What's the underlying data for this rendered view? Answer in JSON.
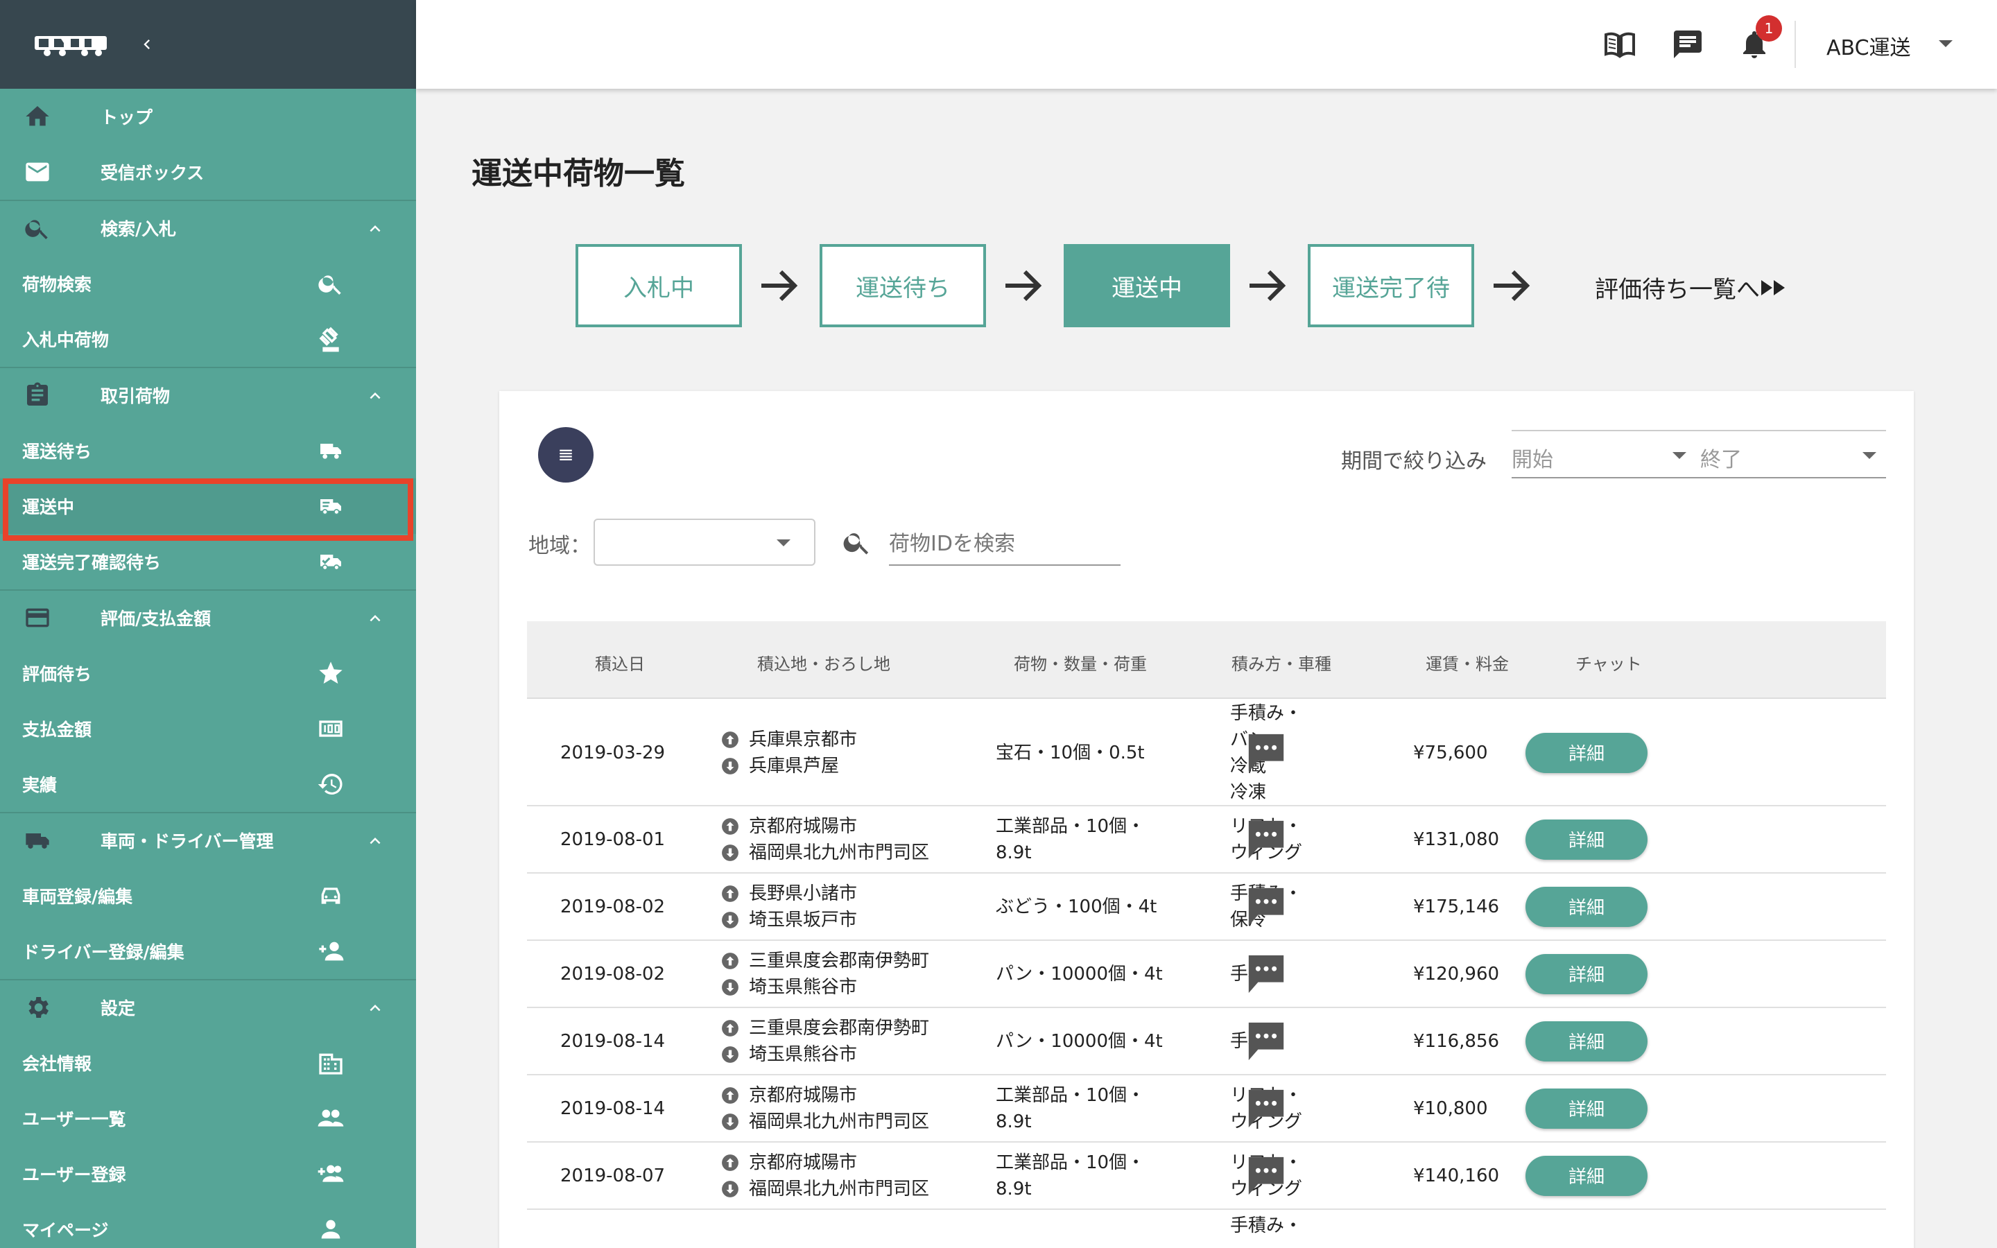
{
  "header": {
    "company": "ABC運送",
    "notification_count": "1"
  },
  "sidebar": {
    "items": [
      {
        "key": "top",
        "label": "トップ",
        "type": "head",
        "icon": "home-icon"
      },
      {
        "key": "inbox",
        "label": "受信ボックス",
        "type": "head",
        "icon": "mail-icon"
      },
      {
        "key": "search-bid",
        "label": "検索/入札",
        "type": "head",
        "icon": "search-icon",
        "chevron": true
      },
      {
        "key": "cargo-search",
        "label": "荷物検索",
        "type": "sub",
        "icon": "search-icon"
      },
      {
        "key": "bidding-cargo",
        "label": "入札中荷物",
        "type": "sub",
        "icon": "gavel-icon"
      },
      {
        "key": "trade-cargo",
        "label": "取引荷物",
        "type": "head",
        "icon": "clipboard-icon",
        "chevron": true
      },
      {
        "key": "awaiting-transport",
        "label": "運送待ち",
        "type": "sub",
        "icon": "truck-icon"
      },
      {
        "key": "in-transit",
        "label": "運送中",
        "type": "sub",
        "icon": "truck-fast-icon"
      },
      {
        "key": "awaiting-completion",
        "label": "運送完了確認待ち",
        "type": "sub",
        "icon": "truck-check-icon"
      },
      {
        "key": "rating-payment",
        "label": "評価/支払金額",
        "type": "head",
        "icon": "credit-card-icon",
        "chevron": true
      },
      {
        "key": "awaiting-rating",
        "label": "評価待ち",
        "type": "sub",
        "icon": "star-icon"
      },
      {
        "key": "payment-amount",
        "label": "支払金額",
        "type": "sub",
        "icon": "money-icon"
      },
      {
        "key": "history",
        "label": "実績",
        "type": "sub",
        "icon": "history-icon"
      },
      {
        "key": "vehicle-driver",
        "label": "車両・ドライバー管理",
        "type": "head",
        "icon": "truck-icon",
        "chevron": true
      },
      {
        "key": "vehicle-edit",
        "label": "車両登録/編集",
        "type": "sub",
        "icon": "car-icon"
      },
      {
        "key": "driver-edit",
        "label": "ドライバー登録/編集",
        "type": "sub",
        "icon": "person-add-icon"
      },
      {
        "key": "settings",
        "label": "設定",
        "type": "head",
        "icon": "gear-icon",
        "chevron": true
      },
      {
        "key": "company-info",
        "label": "会社情報",
        "type": "sub",
        "icon": "building-icon"
      },
      {
        "key": "user-list",
        "label": "ユーザー一覧",
        "type": "sub",
        "icon": "people-icon"
      },
      {
        "key": "user-register",
        "label": "ユーザー登録",
        "type": "sub",
        "icon": "group-add-icon"
      },
      {
        "key": "my-page",
        "label": "マイページ",
        "type": "sub",
        "icon": "person-icon"
      }
    ]
  },
  "page": {
    "title": "運送中荷物一覧"
  },
  "steps": {
    "bidding": "入札中",
    "awaiting": "運送待ち",
    "in_transit": "運送中",
    "awaiting_done": "運送完了待",
    "eval_link": "評価待ち一覧へ"
  },
  "filters": {
    "period_label": "期間で絞り込み",
    "start": "開始",
    "end": "終了",
    "region_label": "地域：",
    "search_placeholder": "荷物IDを検索"
  },
  "table": {
    "headers": [
      "積込日",
      "積込地・おろし地",
      "荷物・数量・荷重",
      "積み方・車種",
      "運賃・料金",
      "チャット"
    ],
    "detail_label": "詳細",
    "rows": [
      {
        "date": "2019-03-29",
        "from": "兵庫県京都市",
        "to": "兵庫県芦屋",
        "cargo": [
          "宝石・10個・0.5t"
        ],
        "loading": [
          "手積み・",
          "バン",
          "冷蔵",
          "冷凍"
        ],
        "fare": "¥75,600"
      },
      {
        "date": "2019-08-01",
        "from": "京都府城陽市",
        "to": "福岡県北九州市門司区",
        "cargo": [
          "工業部品・10個・",
          "8.9t"
        ],
        "loading": [
          "リフト・",
          "ウィング"
        ],
        "fare": "¥131,080"
      },
      {
        "date": "2019-08-02",
        "from": "長野県小諸市",
        "to": "埼玉県坂戸市",
        "cargo": [
          "ぶどう・100個・4t"
        ],
        "loading": [
          "手積み・",
          "保冷"
        ],
        "fare": "¥175,146"
      },
      {
        "date": "2019-08-02",
        "from": "三重県度会郡南伊勢町",
        "to": "埼玉県熊谷市",
        "cargo": [
          "パン・10000個・4t"
        ],
        "loading": [
          "手積み"
        ],
        "fare": "¥120,960"
      },
      {
        "date": "2019-08-14",
        "from": "三重県度会郡南伊勢町",
        "to": "埼玉県熊谷市",
        "cargo": [
          "パン・10000個・4t"
        ],
        "loading": [
          "手積み"
        ],
        "fare": "¥116,856"
      },
      {
        "date": "2019-08-14",
        "from": "京都府城陽市",
        "to": "福岡県北九州市門司区",
        "cargo": [
          "工業部品・10個・",
          "8.9t"
        ],
        "loading": [
          "リフト・",
          "ウィング"
        ],
        "fare": "¥10,800"
      },
      {
        "date": "2019-08-07",
        "from": "京都府城陽市",
        "to": "福岡県北九州市門司区",
        "cargo": [
          "工業部品・10個・",
          "8.9t"
        ],
        "loading": [
          "リフト・",
          "ウィング"
        ],
        "fare": "¥140,160"
      },
      {
        "date": "",
        "from": "",
        "to": "",
        "cargo": [
          ""
        ],
        "loading": [
          "手積み・"
        ],
        "fare": ""
      }
    ]
  },
  "colors": {
    "accent": "#56a597",
    "sidebar_top": "#37474f",
    "highlight": "#e8432a"
  }
}
